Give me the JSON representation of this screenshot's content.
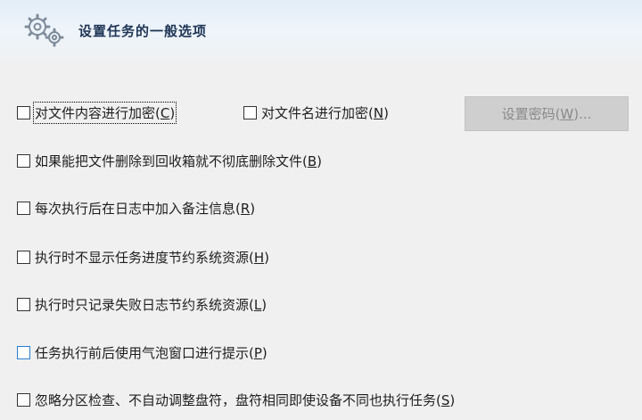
{
  "header": {
    "title": "设置任务的一般选项",
    "icon": "gears-icon"
  },
  "options": {
    "encrypt_content": {
      "text": "对文件内容进行加密(",
      "key": "C",
      "close": ")",
      "checked": false
    },
    "encrypt_name": {
      "text": "对文件名进行加密(",
      "key": "N",
      "close": ")",
      "checked": false
    },
    "permanent_delete": {
      "text": "如果能把文件删除到回收箱就不彻底删除文件(",
      "key": "B",
      "close": ")",
      "checked": false
    },
    "log_note": {
      "text": "每次执行后在日志中加入备注信息(",
      "key": "R",
      "close": ")",
      "checked": false
    },
    "hide_progress": {
      "text": "执行时不显示任务进度节约系统资源(",
      "key": "H",
      "close": ")",
      "checked": false
    },
    "log_failures": {
      "text": "执行时只记录失败日志节约系统资源(",
      "key": "L",
      "close": ")",
      "checked": false
    },
    "balloon_tip": {
      "text": "任务执行前后使用气泡窗口进行提示(",
      "key": "P",
      "close": ")",
      "checked": false
    },
    "ignore_partition": {
      "text": "忽略分区检查、不自动调整盘符，盘符相同即使设备不同也执行任务(",
      "key": "S",
      "close": ")",
      "checked": false
    }
  },
  "set_password": {
    "text": "设置密码(",
    "key": "W",
    "close": ")...",
    "enabled": false
  }
}
